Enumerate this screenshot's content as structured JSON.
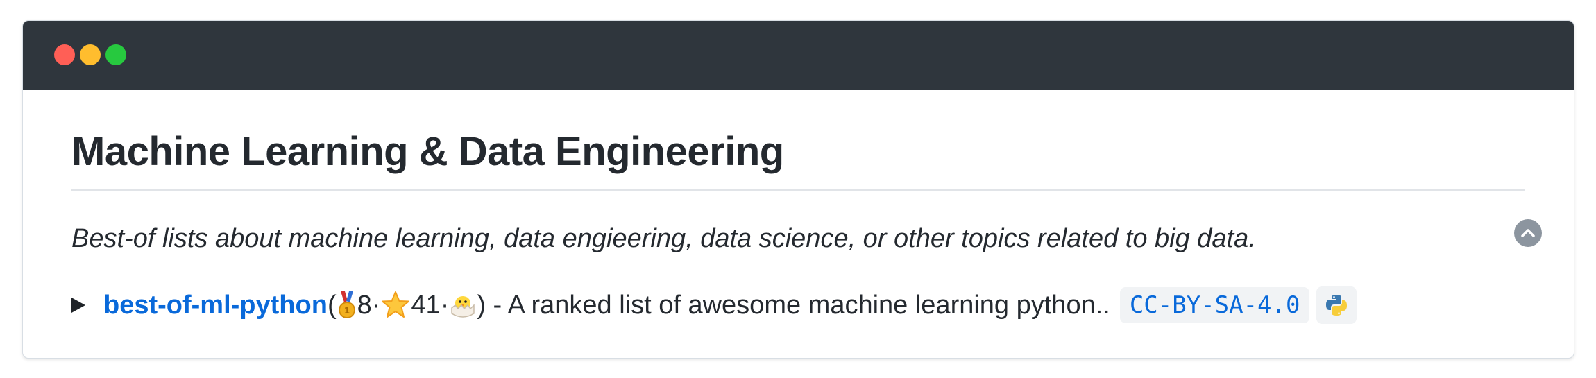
{
  "window": {
    "controls": [
      "close",
      "minimize",
      "maximize"
    ]
  },
  "section": {
    "title": "Machine Learning & Data Engineering",
    "description": "Best-of lists about machine learning, data engieering, data science, or other topics related to big data."
  },
  "entry": {
    "name": "best-of-ml-python",
    "open_paren": " (",
    "medal_count": "8",
    "sep1": " · ",
    "star_count": "41",
    "sep2": " · ",
    "close_text": ") - A ranked list of awesome machine learning python..",
    "license": "CC-BY-SA-4.0",
    "language_icon": "python-icon",
    "medal_icon": "gold-medal-icon",
    "star_icon": "star-icon",
    "new_icon": "hatching-chick-icon"
  },
  "colors": {
    "titlebar": "#2f363d",
    "link": "#0969da",
    "close": "#ff5f56",
    "minimize": "#ffbd2e",
    "maximize": "#27c93f"
  }
}
